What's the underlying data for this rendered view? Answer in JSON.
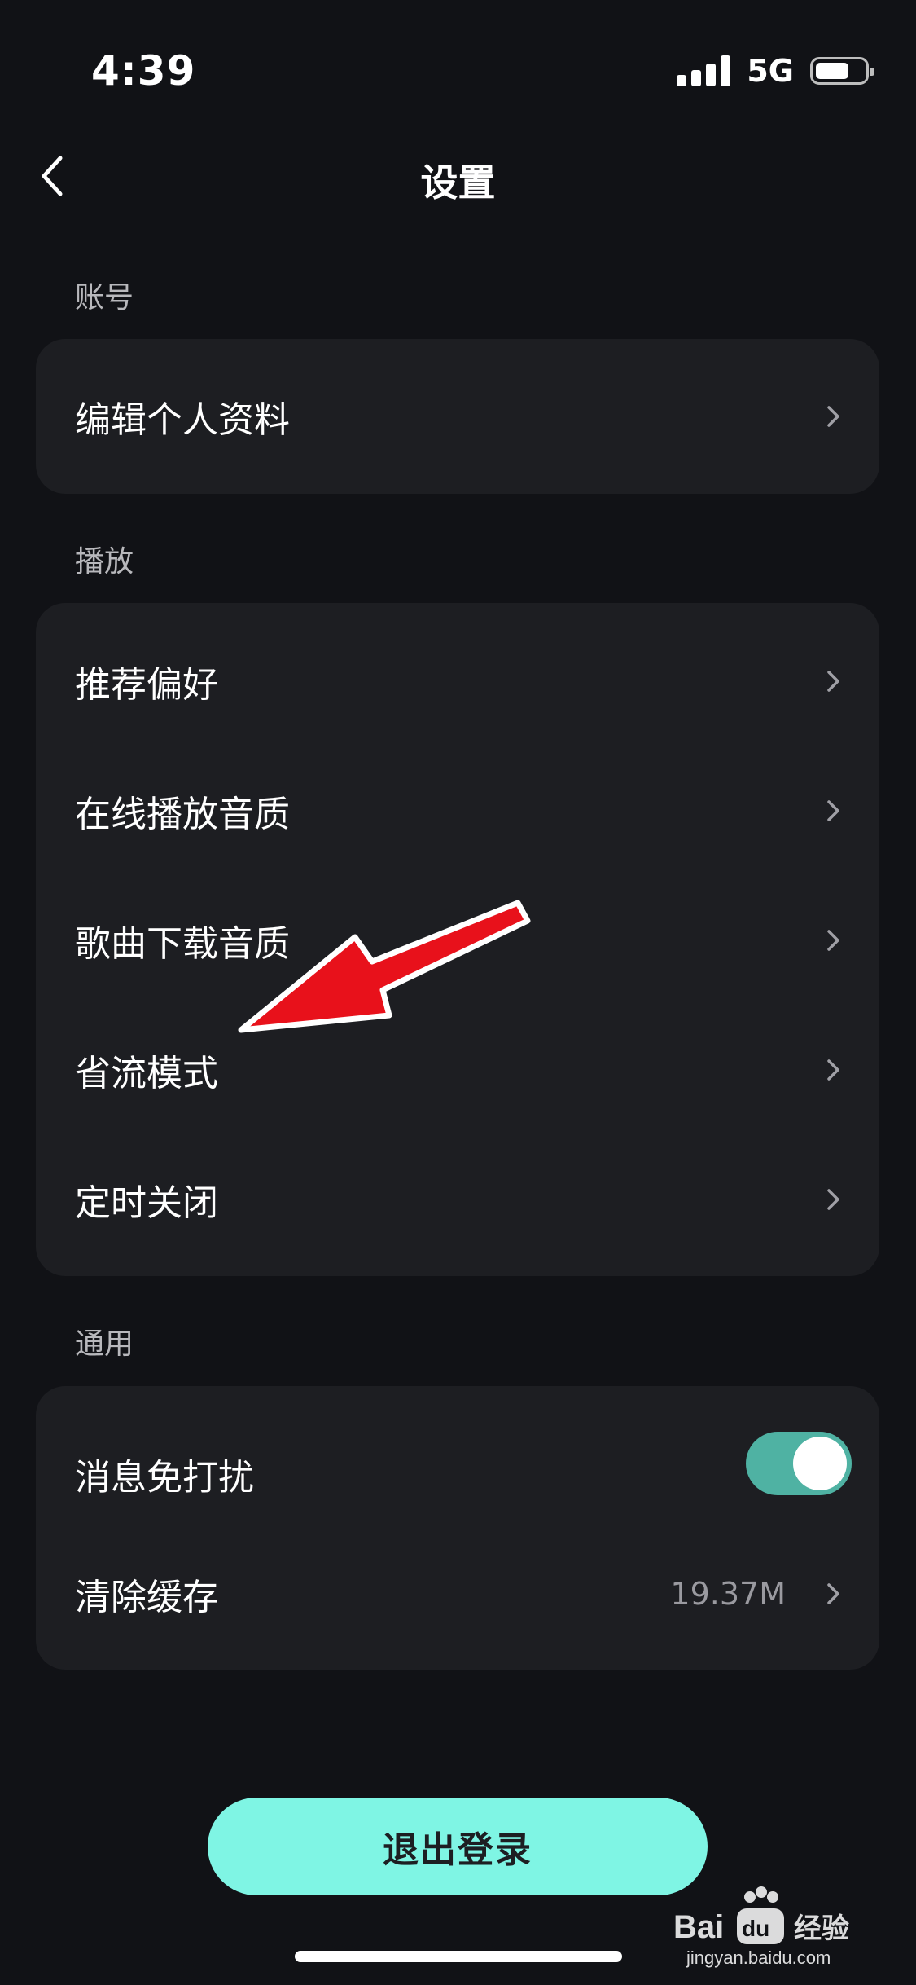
{
  "status_bar": {
    "time": "4:39",
    "network": "5G",
    "battery_level": 0.6
  },
  "nav": {
    "title": "设置"
  },
  "sections": {
    "account": {
      "title": "账号",
      "items": [
        {
          "label": "编辑个人资料"
        }
      ]
    },
    "playback": {
      "title": "播放",
      "items": [
        {
          "label": "推荐偏好"
        },
        {
          "label": "在线播放音质"
        },
        {
          "label": "歌曲下载音质"
        },
        {
          "label": "省流模式"
        },
        {
          "label": "定时关闭"
        }
      ]
    },
    "general": {
      "title": "通用",
      "dnd": {
        "label": "消息免打扰",
        "enabled": true
      },
      "cache": {
        "label": "清除缓存",
        "value": "19.37M"
      }
    }
  },
  "logout_label": "退出登录",
  "watermark": {
    "brand": "Bai",
    "brand2": "经验",
    "url": "jingyan.baidu.com"
  },
  "colors": {
    "background": "#111216",
    "card": "#1d1e22",
    "toggle_on": "#4fb2a3",
    "logout_button": "#7ff5e4",
    "annotation_arrow": "#e8111b"
  }
}
